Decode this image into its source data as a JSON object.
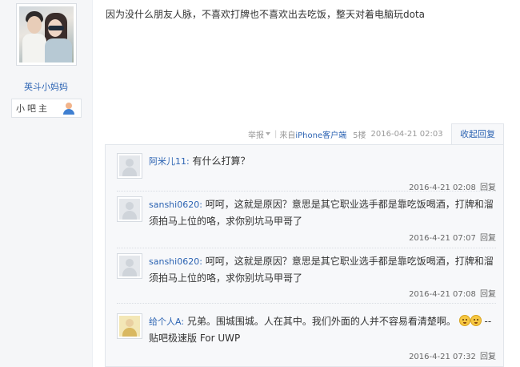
{
  "author": {
    "name": "英斗小妈妈",
    "role": "小吧主"
  },
  "post": {
    "content": "因为没什么朋友人脉，不喜欢打牌也不喜欢出去吃饭，整天对着电脑玩dota",
    "report_label": "举报",
    "client_prefix": "来自",
    "client_name": "iPhone客户端",
    "floor": "5楼",
    "datetime": "2016-04-21 02:03",
    "collapse_label": "收起回复"
  },
  "replies": [
    {
      "user": "阿米儿11:",
      "text": "有什么打算？",
      "time": "2016-4-21 02:08",
      "reply_label": "回复"
    },
    {
      "user": "sanshi0620:",
      "text": "呵呵，这就是原因？意思是其它职业选手都是靠吃饭喝酒，打牌和溜须拍马上位的咯，求你别坑马甲哥了",
      "time": "2016-4-21 07:07",
      "reply_label": "回复"
    },
    {
      "user": "sanshi0620:",
      "text": "呵呵，这就是原因？意思是其它职业选手都是靠吃饭喝酒，打牌和溜须拍马上位的咯，求你别坑马甲哥了",
      "time": "2016-4-21 07:08",
      "reply_label": "回复"
    },
    {
      "user": "给个人A:",
      "text": "兄弟。围城围城。人在其中。我们外面的人并不容易看清楚啊。",
      "suffix": "--贴吧极速版 For UWP",
      "time": "2016-4-21 07:32",
      "reply_label": "回复"
    }
  ],
  "icons": [
    "user-role-icon",
    "dropdown-triangle-icon",
    "crying-emoji-icon"
  ]
}
